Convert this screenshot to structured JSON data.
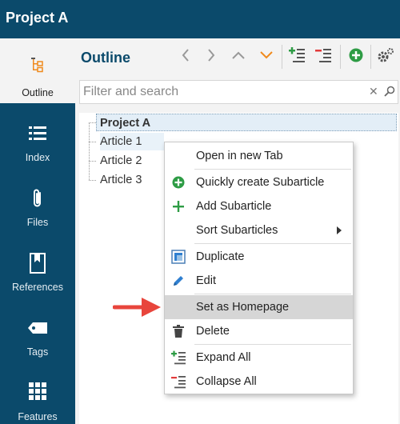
{
  "window": {
    "title": "Project A"
  },
  "sidebar": {
    "items": [
      {
        "label": "Outline",
        "icon": "outline-icon",
        "active": true
      },
      {
        "label": "Index",
        "icon": "list-icon"
      },
      {
        "label": "Files",
        "icon": "paperclip-icon"
      },
      {
        "label": "References",
        "icon": "bookmark-icon"
      },
      {
        "label": "Tags",
        "icon": "tag-icon"
      },
      {
        "label": "Features",
        "icon": "grid-icon"
      }
    ]
  },
  "main": {
    "title": "Outline",
    "toolbar": [
      "back-icon",
      "forward-icon",
      "up-icon",
      "down-icon",
      "expand-all-icon",
      "collapse-all-icon",
      "add-icon",
      "settings-icon"
    ],
    "search": {
      "placeholder": "Filter and search",
      "value": ""
    }
  },
  "tree": {
    "root": "Project A",
    "children": [
      "Article 1",
      "Article 2",
      "Article 3"
    ]
  },
  "context_menu": {
    "items": [
      {
        "label": "Open in new Tab",
        "icon": ""
      },
      {
        "label": "Quickly create Subarticle",
        "icon": "plus-circle-icon"
      },
      {
        "label": "Add Subarticle",
        "icon": "plus-icon"
      },
      {
        "label": "Sort Subarticles",
        "icon": "",
        "submenu": true
      },
      {
        "label": "Duplicate",
        "icon": "duplicate-icon"
      },
      {
        "label": "Edit",
        "icon": "pencil-icon"
      },
      {
        "label": "Set as Homepage",
        "icon": "",
        "highlighted": true
      },
      {
        "label": "Delete",
        "icon": "trash-icon"
      },
      {
        "label": "Expand All",
        "icon": "expand-all-icon"
      },
      {
        "label": "Collapse All",
        "icon": "collapse-all-icon"
      }
    ]
  },
  "colors": {
    "brand": "#0b4a6b",
    "accent_orange": "#f08a1c",
    "green": "#2e9c45",
    "red": "#e23b3b",
    "blue": "#2f7fd0"
  }
}
